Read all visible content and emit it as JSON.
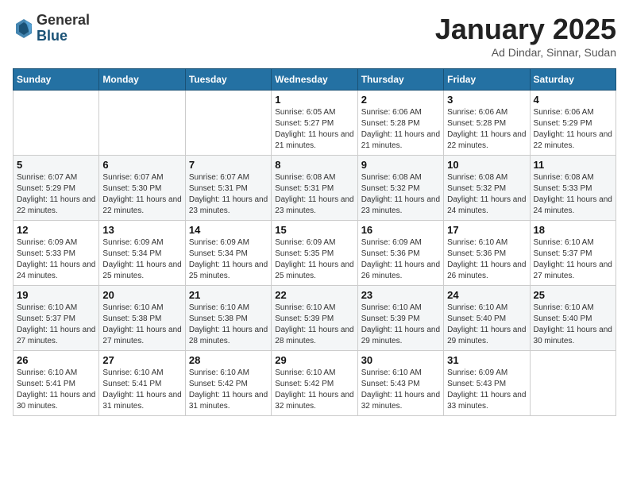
{
  "logo": {
    "general": "General",
    "blue": "Blue"
  },
  "header": {
    "month": "January 2025",
    "location": "Ad Dindar, Sinnar, Sudan"
  },
  "weekdays": [
    "Sunday",
    "Monday",
    "Tuesday",
    "Wednesday",
    "Thursday",
    "Friday",
    "Saturday"
  ],
  "weeks": [
    [
      {
        "day": "",
        "info": ""
      },
      {
        "day": "",
        "info": ""
      },
      {
        "day": "",
        "info": ""
      },
      {
        "day": "1",
        "info": "Sunrise: 6:05 AM\nSunset: 5:27 PM\nDaylight: 11 hours and 21 minutes."
      },
      {
        "day": "2",
        "info": "Sunrise: 6:06 AM\nSunset: 5:28 PM\nDaylight: 11 hours and 21 minutes."
      },
      {
        "day": "3",
        "info": "Sunrise: 6:06 AM\nSunset: 5:28 PM\nDaylight: 11 hours and 22 minutes."
      },
      {
        "day": "4",
        "info": "Sunrise: 6:06 AM\nSunset: 5:29 PM\nDaylight: 11 hours and 22 minutes."
      }
    ],
    [
      {
        "day": "5",
        "info": "Sunrise: 6:07 AM\nSunset: 5:29 PM\nDaylight: 11 hours and 22 minutes."
      },
      {
        "day": "6",
        "info": "Sunrise: 6:07 AM\nSunset: 5:30 PM\nDaylight: 11 hours and 22 minutes."
      },
      {
        "day": "7",
        "info": "Sunrise: 6:07 AM\nSunset: 5:31 PM\nDaylight: 11 hours and 23 minutes."
      },
      {
        "day": "8",
        "info": "Sunrise: 6:08 AM\nSunset: 5:31 PM\nDaylight: 11 hours and 23 minutes."
      },
      {
        "day": "9",
        "info": "Sunrise: 6:08 AM\nSunset: 5:32 PM\nDaylight: 11 hours and 23 minutes."
      },
      {
        "day": "10",
        "info": "Sunrise: 6:08 AM\nSunset: 5:32 PM\nDaylight: 11 hours and 24 minutes."
      },
      {
        "day": "11",
        "info": "Sunrise: 6:08 AM\nSunset: 5:33 PM\nDaylight: 11 hours and 24 minutes."
      }
    ],
    [
      {
        "day": "12",
        "info": "Sunrise: 6:09 AM\nSunset: 5:33 PM\nDaylight: 11 hours and 24 minutes."
      },
      {
        "day": "13",
        "info": "Sunrise: 6:09 AM\nSunset: 5:34 PM\nDaylight: 11 hours and 25 minutes."
      },
      {
        "day": "14",
        "info": "Sunrise: 6:09 AM\nSunset: 5:34 PM\nDaylight: 11 hours and 25 minutes."
      },
      {
        "day": "15",
        "info": "Sunrise: 6:09 AM\nSunset: 5:35 PM\nDaylight: 11 hours and 25 minutes."
      },
      {
        "day": "16",
        "info": "Sunrise: 6:09 AM\nSunset: 5:36 PM\nDaylight: 11 hours and 26 minutes."
      },
      {
        "day": "17",
        "info": "Sunrise: 6:10 AM\nSunset: 5:36 PM\nDaylight: 11 hours and 26 minutes."
      },
      {
        "day": "18",
        "info": "Sunrise: 6:10 AM\nSunset: 5:37 PM\nDaylight: 11 hours and 27 minutes."
      }
    ],
    [
      {
        "day": "19",
        "info": "Sunrise: 6:10 AM\nSunset: 5:37 PM\nDaylight: 11 hours and 27 minutes."
      },
      {
        "day": "20",
        "info": "Sunrise: 6:10 AM\nSunset: 5:38 PM\nDaylight: 11 hours and 27 minutes."
      },
      {
        "day": "21",
        "info": "Sunrise: 6:10 AM\nSunset: 5:38 PM\nDaylight: 11 hours and 28 minutes."
      },
      {
        "day": "22",
        "info": "Sunrise: 6:10 AM\nSunset: 5:39 PM\nDaylight: 11 hours and 28 minutes."
      },
      {
        "day": "23",
        "info": "Sunrise: 6:10 AM\nSunset: 5:39 PM\nDaylight: 11 hours and 29 minutes."
      },
      {
        "day": "24",
        "info": "Sunrise: 6:10 AM\nSunset: 5:40 PM\nDaylight: 11 hours and 29 minutes."
      },
      {
        "day": "25",
        "info": "Sunrise: 6:10 AM\nSunset: 5:40 PM\nDaylight: 11 hours and 30 minutes."
      }
    ],
    [
      {
        "day": "26",
        "info": "Sunrise: 6:10 AM\nSunset: 5:41 PM\nDaylight: 11 hours and 30 minutes."
      },
      {
        "day": "27",
        "info": "Sunrise: 6:10 AM\nSunset: 5:41 PM\nDaylight: 11 hours and 31 minutes."
      },
      {
        "day": "28",
        "info": "Sunrise: 6:10 AM\nSunset: 5:42 PM\nDaylight: 11 hours and 31 minutes."
      },
      {
        "day": "29",
        "info": "Sunrise: 6:10 AM\nSunset: 5:42 PM\nDaylight: 11 hours and 32 minutes."
      },
      {
        "day": "30",
        "info": "Sunrise: 6:10 AM\nSunset: 5:43 PM\nDaylight: 11 hours and 32 minutes."
      },
      {
        "day": "31",
        "info": "Sunrise: 6:09 AM\nSunset: 5:43 PM\nDaylight: 11 hours and 33 minutes."
      },
      {
        "day": "",
        "info": ""
      }
    ]
  ]
}
